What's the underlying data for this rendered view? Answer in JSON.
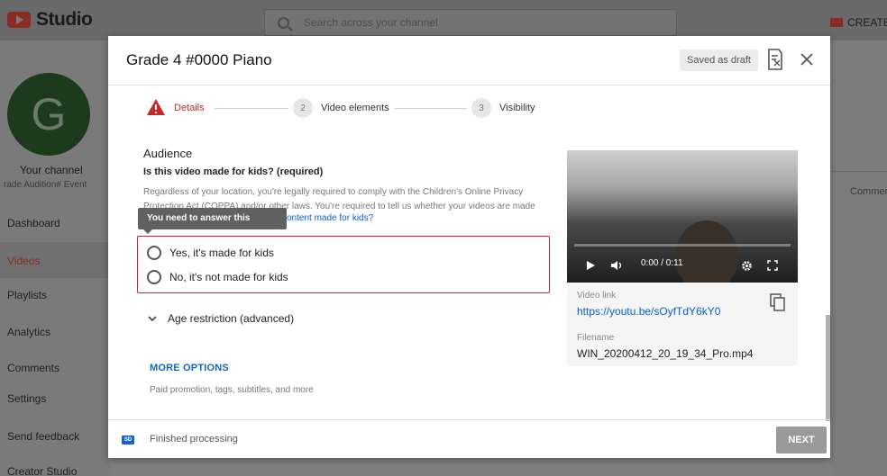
{
  "app": {
    "logo_text": "Studio",
    "search_placeholder": "Search across your channel",
    "create_label": "CREATE"
  },
  "sidebar": {
    "avatar_letter": "G",
    "channel_title": "Your channel",
    "channel_subtitle": "rade Audition# Event",
    "items": [
      {
        "label": "Dashboard"
      },
      {
        "label": "Videos"
      },
      {
        "label": "Playlists"
      },
      {
        "label": "Analytics"
      },
      {
        "label": "Comments"
      },
      {
        "label": "Settings"
      },
      {
        "label": "Send feedback"
      },
      {
        "label": "Creator Studio Classic"
      }
    ]
  },
  "background_right": {
    "comments_label": "Commen"
  },
  "dialog": {
    "title": "Grade 4 #0000 Piano",
    "draft_status": "Saved as draft",
    "steps": [
      {
        "number": "",
        "label": "Details",
        "state": "error"
      },
      {
        "number": "2",
        "label": "Video elements",
        "state": "pending"
      },
      {
        "number": "3",
        "label": "Visibility",
        "state": "pending"
      }
    ],
    "audience": {
      "title": "Audience",
      "question": "Is this video made for kids? (required)",
      "description": "Regardless of your location, you're legally required to comply with the Children's Online Privacy Protection Act (COPPA) and/or other laws. You're required to tell us whether your videos are made for kids.",
      "link": "content made for kids?",
      "tooltip": "You need to answer this question",
      "options": [
        {
          "label": "Yes, it's made for kids",
          "selected": false
        },
        {
          "label": "No, it's not made for kids",
          "selected": false
        }
      ]
    },
    "age_restriction": "Age restriction (advanced)",
    "more_options": {
      "label": "MORE OPTIONS",
      "subtitle": "Paid promotion, tags, subtitles, and more"
    },
    "video": {
      "time": "0:00 / 0:11",
      "link_label": "Video link",
      "link": "https://youtu.be/sOyfTdY6kY0",
      "filename_label": "Filename",
      "filename": "WIN_20200412_20_19_34_Pro.mp4"
    },
    "footer": {
      "quality_badge": "SD",
      "status": "Finished processing",
      "next_label": "NEXT"
    }
  },
  "colors": {
    "error": "#c62828",
    "link": "#065fd4",
    "accent_blue": "#1565c0"
  }
}
